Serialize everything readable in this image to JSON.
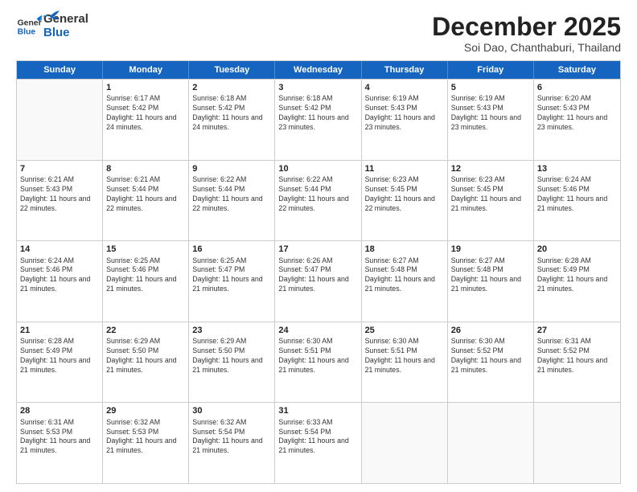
{
  "header": {
    "logo_general": "General",
    "logo_blue": "Blue",
    "month_title": "December 2025",
    "subtitle": "Soi Dao, Chanthaburi, Thailand"
  },
  "days_of_week": [
    "Sunday",
    "Monday",
    "Tuesday",
    "Wednesday",
    "Thursday",
    "Friday",
    "Saturday"
  ],
  "weeks": [
    [
      {
        "day": "",
        "empty": true
      },
      {
        "day": "1",
        "sunrise": "Sunrise: 6:17 AM",
        "sunset": "Sunset: 5:42 PM",
        "daylight": "Daylight: 11 hours and 24 minutes."
      },
      {
        "day": "2",
        "sunrise": "Sunrise: 6:18 AM",
        "sunset": "Sunset: 5:42 PM",
        "daylight": "Daylight: 11 hours and 24 minutes."
      },
      {
        "day": "3",
        "sunrise": "Sunrise: 6:18 AM",
        "sunset": "Sunset: 5:42 PM",
        "daylight": "Daylight: 11 hours and 23 minutes."
      },
      {
        "day": "4",
        "sunrise": "Sunrise: 6:19 AM",
        "sunset": "Sunset: 5:43 PM",
        "daylight": "Daylight: 11 hours and 23 minutes."
      },
      {
        "day": "5",
        "sunrise": "Sunrise: 6:19 AM",
        "sunset": "Sunset: 5:43 PM",
        "daylight": "Daylight: 11 hours and 23 minutes."
      },
      {
        "day": "6",
        "sunrise": "Sunrise: 6:20 AM",
        "sunset": "Sunset: 5:43 PM",
        "daylight": "Daylight: 11 hours and 23 minutes."
      }
    ],
    [
      {
        "day": "7",
        "sunrise": "Sunrise: 6:21 AM",
        "sunset": "Sunset: 5:43 PM",
        "daylight": "Daylight: 11 hours and 22 minutes."
      },
      {
        "day": "8",
        "sunrise": "Sunrise: 6:21 AM",
        "sunset": "Sunset: 5:44 PM",
        "daylight": "Daylight: 11 hours and 22 minutes."
      },
      {
        "day": "9",
        "sunrise": "Sunrise: 6:22 AM",
        "sunset": "Sunset: 5:44 PM",
        "daylight": "Daylight: 11 hours and 22 minutes."
      },
      {
        "day": "10",
        "sunrise": "Sunrise: 6:22 AM",
        "sunset": "Sunset: 5:44 PM",
        "daylight": "Daylight: 11 hours and 22 minutes."
      },
      {
        "day": "11",
        "sunrise": "Sunrise: 6:23 AM",
        "sunset": "Sunset: 5:45 PM",
        "daylight": "Daylight: 11 hours and 22 minutes."
      },
      {
        "day": "12",
        "sunrise": "Sunrise: 6:23 AM",
        "sunset": "Sunset: 5:45 PM",
        "daylight": "Daylight: 11 hours and 21 minutes."
      },
      {
        "day": "13",
        "sunrise": "Sunrise: 6:24 AM",
        "sunset": "Sunset: 5:46 PM",
        "daylight": "Daylight: 11 hours and 21 minutes."
      }
    ],
    [
      {
        "day": "14",
        "sunrise": "Sunrise: 6:24 AM",
        "sunset": "Sunset: 5:46 PM",
        "daylight": "Daylight: 11 hours and 21 minutes."
      },
      {
        "day": "15",
        "sunrise": "Sunrise: 6:25 AM",
        "sunset": "Sunset: 5:46 PM",
        "daylight": "Daylight: 11 hours and 21 minutes."
      },
      {
        "day": "16",
        "sunrise": "Sunrise: 6:25 AM",
        "sunset": "Sunset: 5:47 PM",
        "daylight": "Daylight: 11 hours and 21 minutes."
      },
      {
        "day": "17",
        "sunrise": "Sunrise: 6:26 AM",
        "sunset": "Sunset: 5:47 PM",
        "daylight": "Daylight: 11 hours and 21 minutes."
      },
      {
        "day": "18",
        "sunrise": "Sunrise: 6:27 AM",
        "sunset": "Sunset: 5:48 PM",
        "daylight": "Daylight: 11 hours and 21 minutes."
      },
      {
        "day": "19",
        "sunrise": "Sunrise: 6:27 AM",
        "sunset": "Sunset: 5:48 PM",
        "daylight": "Daylight: 11 hours and 21 minutes."
      },
      {
        "day": "20",
        "sunrise": "Sunrise: 6:28 AM",
        "sunset": "Sunset: 5:49 PM",
        "daylight": "Daylight: 11 hours and 21 minutes."
      }
    ],
    [
      {
        "day": "21",
        "sunrise": "Sunrise: 6:28 AM",
        "sunset": "Sunset: 5:49 PM",
        "daylight": "Daylight: 11 hours and 21 minutes."
      },
      {
        "day": "22",
        "sunrise": "Sunrise: 6:29 AM",
        "sunset": "Sunset: 5:50 PM",
        "daylight": "Daylight: 11 hours and 21 minutes."
      },
      {
        "day": "23",
        "sunrise": "Sunrise: 6:29 AM",
        "sunset": "Sunset: 5:50 PM",
        "daylight": "Daylight: 11 hours and 21 minutes."
      },
      {
        "day": "24",
        "sunrise": "Sunrise: 6:30 AM",
        "sunset": "Sunset: 5:51 PM",
        "daylight": "Daylight: 11 hours and 21 minutes."
      },
      {
        "day": "25",
        "sunrise": "Sunrise: 6:30 AM",
        "sunset": "Sunset: 5:51 PM",
        "daylight": "Daylight: 11 hours and 21 minutes."
      },
      {
        "day": "26",
        "sunrise": "Sunrise: 6:30 AM",
        "sunset": "Sunset: 5:52 PM",
        "daylight": "Daylight: 11 hours and 21 minutes."
      },
      {
        "day": "27",
        "sunrise": "Sunrise: 6:31 AM",
        "sunset": "Sunset: 5:52 PM",
        "daylight": "Daylight: 11 hours and 21 minutes."
      }
    ],
    [
      {
        "day": "28",
        "sunrise": "Sunrise: 6:31 AM",
        "sunset": "Sunset: 5:53 PM",
        "daylight": "Daylight: 11 hours and 21 minutes."
      },
      {
        "day": "29",
        "sunrise": "Sunrise: 6:32 AM",
        "sunset": "Sunset: 5:53 PM",
        "daylight": "Daylight: 11 hours and 21 minutes."
      },
      {
        "day": "30",
        "sunrise": "Sunrise: 6:32 AM",
        "sunset": "Sunset: 5:54 PM",
        "daylight": "Daylight: 11 hours and 21 minutes."
      },
      {
        "day": "31",
        "sunrise": "Sunrise: 6:33 AM",
        "sunset": "Sunset: 5:54 PM",
        "daylight": "Daylight: 11 hours and 21 minutes."
      },
      {
        "day": "",
        "empty": true
      },
      {
        "day": "",
        "empty": true
      },
      {
        "day": "",
        "empty": true
      }
    ]
  ]
}
